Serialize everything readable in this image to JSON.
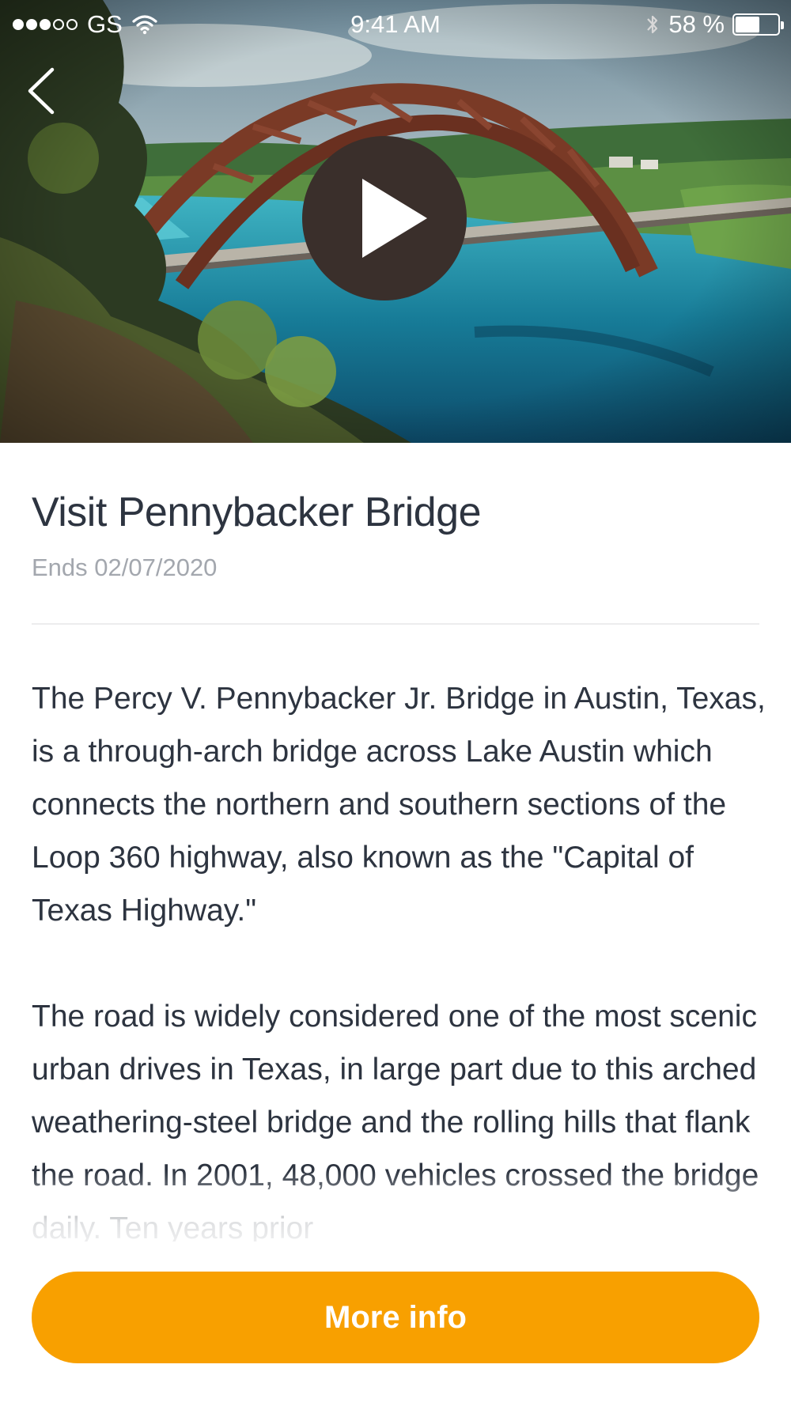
{
  "status_bar": {
    "signal_dots_filled": 3,
    "signal_dots_total": 5,
    "carrier": "GS",
    "time": "9:41 AM",
    "battery_percent": "58 %",
    "battery_level": 0.58,
    "icons": [
      "wifi-icon",
      "bluetooth-icon",
      "battery-icon"
    ]
  },
  "hero": {
    "image": "Pennybacker Bridge arch over Lake Austin",
    "back_icon": "chevron-left-icon",
    "play_icon": "play-icon"
  },
  "detail": {
    "title": "Visit Pennybacker Bridge",
    "ends": "Ends 02/07/2020",
    "paragraphs": [
      "The Percy V. Pennybacker Jr. Bridge in Austin, Texas, is a through-arch bridge across Lake Austin which connects the northern and southern sections of the Loop 360 highway, also known as the \"Capital of Texas Highway.\"",
      "The road is widely considered one of the most scenic urban drives in Texas, in large part due to this arched weathering-steel bridge and the rolling hills that flank the road. In 2001, 48,000 vehicles crossed the bridge daily. Ten years prior"
    ]
  },
  "actions": {
    "more_info_label": "More info"
  },
  "colors": {
    "accent": "#f8a000",
    "title_text": "#2d3440",
    "muted_text": "#a3a7ae",
    "play_button": "#3a2f2b"
  }
}
